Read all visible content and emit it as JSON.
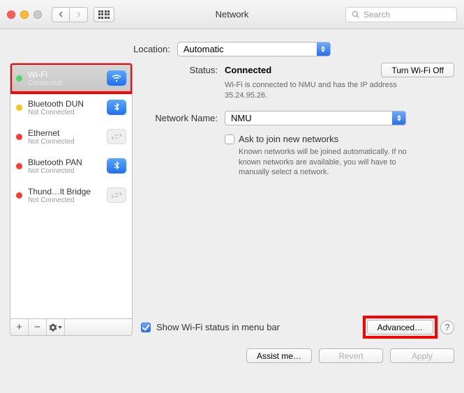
{
  "window": {
    "title": "Network"
  },
  "search": {
    "placeholder": "Search"
  },
  "location": {
    "label": "Location:",
    "value": "Automatic"
  },
  "sidebar": {
    "items": [
      {
        "name": "Wi-Fi",
        "sub": "Connected",
        "status": "green",
        "icon": "wifi",
        "iconStyle": "blue",
        "selected": true
      },
      {
        "name": "Bluetooth DUN",
        "sub": "Not Connected",
        "status": "yellow",
        "icon": "bluetooth",
        "iconStyle": "blue",
        "selected": false
      },
      {
        "name": "Ethernet",
        "sub": "Not Connected",
        "status": "red",
        "icon": "ethernet",
        "iconStyle": "gray",
        "selected": false
      },
      {
        "name": "Bluetooth PAN",
        "sub": "Not Connected",
        "status": "red",
        "icon": "bluetooth",
        "iconStyle": "blue",
        "selected": false
      },
      {
        "name": "Thund…lt Bridge",
        "sub": "Not Connected",
        "status": "red",
        "icon": "ethernet",
        "iconStyle": "gray",
        "selected": false
      }
    ],
    "footer": {
      "add": "+",
      "remove": "−"
    }
  },
  "detail": {
    "status_label": "Status:",
    "status_value": "Connected",
    "turn_off_label": "Turn Wi-Fi Off",
    "status_desc": "Wi-Fi is connected to NMU and has the IP address 35.24.95.26.",
    "network_name_label": "Network Name:",
    "network_name_value": "NMU",
    "ask_join_label": "Ask to join new networks",
    "ask_join_desc": "Known networks will be joined automatically. If no known networks are available, you will have to manually select a network.",
    "show_menubar_label": "Show Wi-Fi status in menu bar",
    "advanced_label": "Advanced…",
    "help": "?"
  },
  "buttons": {
    "assist": "Assist me…",
    "revert": "Revert",
    "apply": "Apply"
  }
}
